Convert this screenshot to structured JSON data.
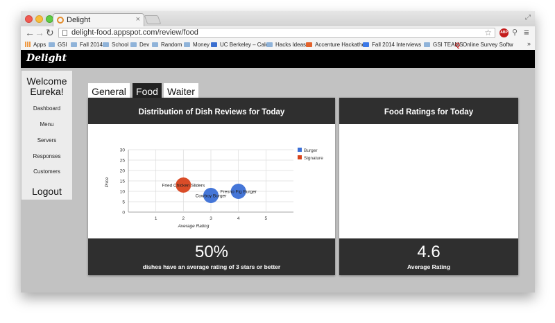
{
  "browser": {
    "tab_title": "Delight",
    "url": "delight-food.appspot.com/review/food",
    "bookmarks": [
      "Apps",
      "GSI",
      "Fall 2014",
      "School",
      "Dev",
      "Random",
      "Money",
      "UC Berkeley – Calen",
      "Hacks Ideas",
      "Accenture Hackathon",
      "Fall 2014 Interviews",
      "GSI TEAMS",
      "Online Survey Softw"
    ],
    "adblock_label": "ABP",
    "colors": {
      "close": "#f25a52",
      "minimize": "#f7bd3c",
      "maximize": "#5fcc45"
    }
  },
  "app": {
    "logo": "Delight"
  },
  "sidebar": {
    "welcome_line1": "Welcome",
    "welcome_line2": "Eureka!",
    "items": [
      "Dashboard",
      "Menu",
      "Servers",
      "Responses",
      "Customers"
    ],
    "logout": "Logout"
  },
  "tabs": [
    {
      "label": "General",
      "active": false
    },
    {
      "label": "Food",
      "active": true
    },
    {
      "label": "Waiter",
      "active": false
    }
  ],
  "panels": {
    "distribution": {
      "title": "Distribution of Dish Reviews for Today",
      "stat": "50%",
      "stat_label": "dishes have an average rating of 3 stars or better"
    },
    "ratings": {
      "title": "Food Ratings for Today",
      "stat": "4.6",
      "stat_label": "Average Rating"
    }
  },
  "chart_data": {
    "type": "scatter",
    "title": "",
    "xlabel": "Average Rating",
    "ylabel": "Price",
    "xlim": [
      0,
      6
    ],
    "ylim": [
      0,
      30
    ],
    "xticks": [
      1,
      2,
      3,
      4,
      5
    ],
    "yticks": [
      0,
      5,
      10,
      15,
      20,
      25,
      30
    ],
    "grid": true,
    "legend_position": "right",
    "series": [
      {
        "name": "Burger",
        "color": "#3b6fd6",
        "points": [
          {
            "label": "Cowboy Burger",
            "x": 3,
            "y": 8
          },
          {
            "label": "Fresno Fig Burger",
            "x": 4,
            "y": 10
          }
        ]
      },
      {
        "name": "Signature",
        "color": "#d8431c",
        "points": [
          {
            "label": "Fried Chicken Sliders",
            "x": 2,
            "y": 13
          }
        ]
      }
    ]
  }
}
